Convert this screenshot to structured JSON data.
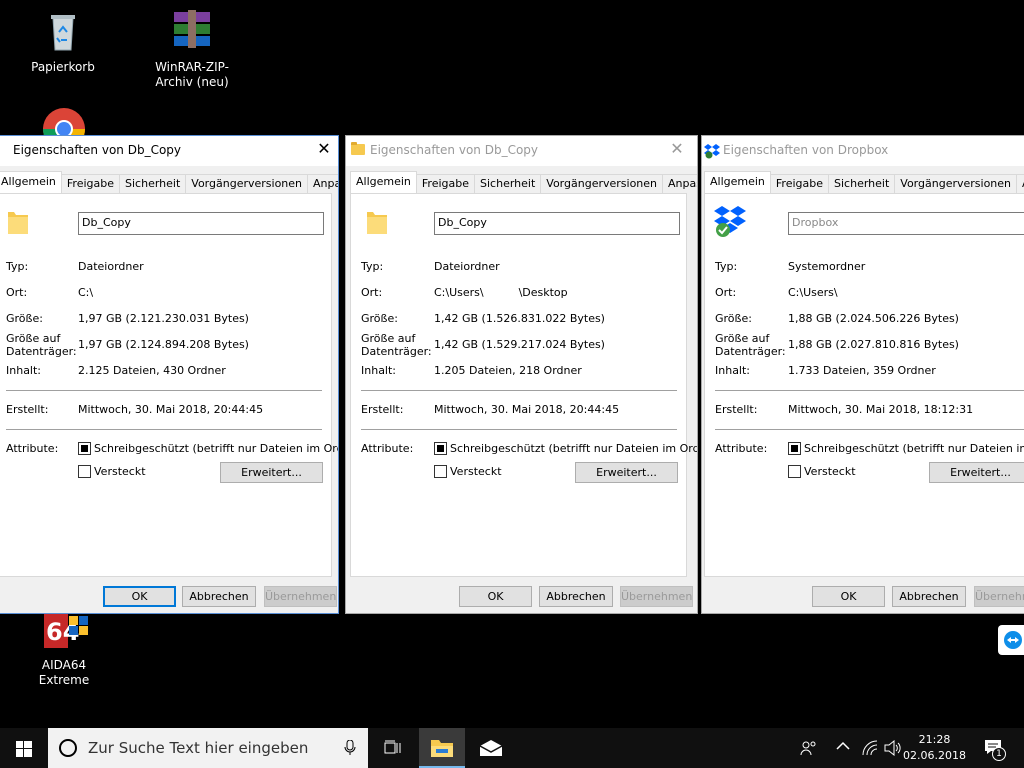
{
  "desktop": {
    "icons": [
      {
        "label": "Papierkorb"
      },
      {
        "label": "WinRAR-ZIP-Archiv (neu)"
      },
      {
        "label": "AIDA64 Extreme"
      }
    ]
  },
  "common": {
    "tabs": [
      "Allgemein",
      "Freigabe",
      "Sicherheit",
      "Vorgängerversionen",
      "Anpassen"
    ],
    "labels": {
      "typ": "Typ:",
      "ort": "Ort:",
      "groesse": "Größe:",
      "groesse_disk": "Größe auf Datenträger:",
      "inhalt": "Inhalt:",
      "erstellt": "Erstellt:",
      "attribute": "Attribute:"
    },
    "readonly_label": "Schreibgeschützt (betrifft nur Dateien im Ordner)",
    "hidden_label": "Versteckt",
    "advanced_button": "Erweitert...",
    "ok_button": "OK",
    "cancel_button": "Abbrechen",
    "apply_button": "Übernehmen"
  },
  "dialogs": [
    {
      "title": "Eigenschaften von Db_Copy",
      "name": "Db_Copy",
      "typ": "Dateiordner",
      "ort": "C:\\",
      "groesse": "1,97 GB (2.121.230.031 Bytes)",
      "groesse_disk": "1,97 GB (2.124.894.208 Bytes)",
      "inhalt": "2.125 Dateien, 430 Ordner",
      "erstellt": "Mittwoch, 30. Mai 2018, 20:44:45",
      "readonly": true,
      "hidden": false
    },
    {
      "title": "Eigenschaften von Db_Copy",
      "name": "Db_Copy",
      "typ": "Dateiordner",
      "ort": "C:\\Users\\          \\Desktop",
      "groesse": "1,42 GB (1.526.831.022 Bytes)",
      "groesse_disk": "1,42 GB (1.529.217.024 Bytes)",
      "inhalt": "1.205 Dateien, 218 Ordner",
      "erstellt": "Mittwoch, 30. Mai 2018, 20:44:45",
      "readonly": true,
      "hidden": false
    },
    {
      "title": "Eigenschaften von Dropbox",
      "name": "Dropbox",
      "typ": "Systemordner",
      "ort": "C:\\Users\\",
      "groesse": "1,88 GB (2.024.506.226 Bytes)",
      "groesse_disk": "1,88 GB (2.027.810.816 Bytes)",
      "inhalt": "1.733 Dateien, 359 Ordner",
      "erstellt": "Mittwoch, 30. Mai 2018, 18:12:31",
      "readonly": true,
      "hidden": false
    }
  ],
  "taskbar": {
    "search_placeholder": "Zur Suche Text hier eingeben",
    "time": "21:28",
    "date": "02.06.2018",
    "notification_count": "1"
  },
  "colors": {
    "accent": "#0078d7",
    "folder": "#f6c94f",
    "dropbox": "#0061fe"
  }
}
